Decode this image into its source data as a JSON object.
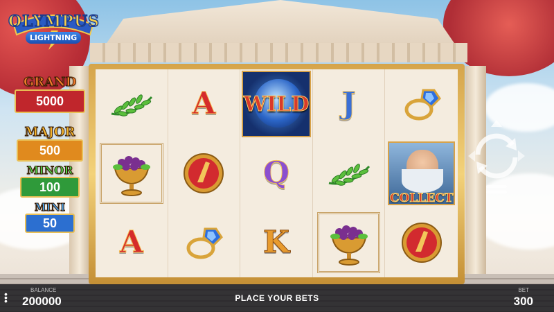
{
  "logo": {
    "title": "OLYMPUS",
    "subtitle": "LIGHTNING"
  },
  "jackpots": [
    {
      "label": "GRAND",
      "value": "5000",
      "color": "#c0262c",
      "label_color": "#f07a2a"
    },
    {
      "label": "MAJOR",
      "value": "500",
      "color": "#e08a1e",
      "label_color": "#f5b52e"
    },
    {
      "label": "MINOR",
      "value": "100",
      "color": "#2f9a3a",
      "label_color": "#4fcf4a"
    },
    {
      "label": "MINI",
      "value": "50",
      "color": "#2c6fd0",
      "label_color": "#4aa6f2"
    }
  ],
  "reels": {
    "rows": [
      [
        "laurel-icon",
        "letter-a",
        "wild",
        "letter-j",
        "ring-icon"
      ],
      [
        "goblet-icon",
        "shield-icon",
        "letter-q",
        "laurel-icon",
        "zeus-collect"
      ],
      [
        "letter-a",
        "ring-icon",
        "letter-k",
        "goblet-icon",
        "shield-icon"
      ]
    ],
    "letters": {
      "a": "A",
      "j": "J",
      "q": "Q",
      "k": "K"
    },
    "wild_label": "WILD",
    "collect_label": "COLLECT"
  },
  "bottom_bar": {
    "balance_label": "BALANCE",
    "balance_value": "200000",
    "center_text": "PLACE YOUR BETS",
    "bet_label": "BET",
    "bet_value": "300"
  },
  "controls": {
    "spin_icon": "spin-arrows-icon",
    "menu_icon": "menu-dots-icon"
  }
}
